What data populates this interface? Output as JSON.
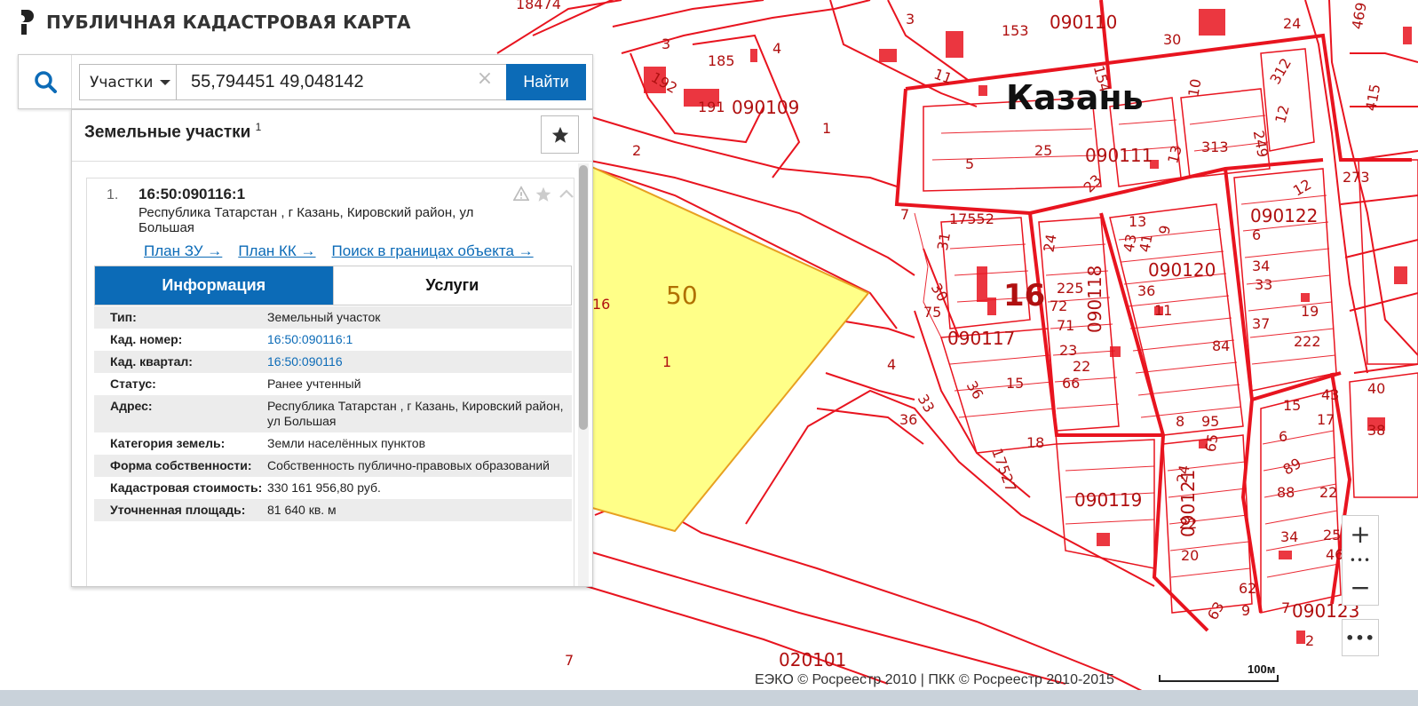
{
  "app": {
    "title": "ПУБЛИЧНАЯ КАДАСТРОВАЯ КАРТА"
  },
  "search": {
    "type_label": "Участки",
    "query": "55,794451 49,048142",
    "clear_label": "×",
    "submit_label": "Найти"
  },
  "results": {
    "title": "Земельные участки",
    "count": "1",
    "items": [
      {
        "index": "1.",
        "cad_number": "16:50:090116:1",
        "address": "Республика Татарстан , г Казань, Кировский район, ул Большая",
        "links": [
          {
            "label": "План ЗУ →"
          },
          {
            "label": "План КК →"
          },
          {
            "label": "Поиск в границах объекта →"
          }
        ],
        "tabs": [
          {
            "label": "Информация"
          },
          {
            "label": "Услуги"
          }
        ],
        "fields": [
          {
            "key": "Тип:",
            "value": "Земельный участок"
          },
          {
            "key": "Кад. номер:",
            "value": "16:50:090116:1"
          },
          {
            "key": "Кад. квартал:",
            "value": "16:50:090116"
          },
          {
            "key": "Статус:",
            "value": "Ранее учтенный"
          },
          {
            "key": "Адрес:",
            "value": "Республика Татарстан , г Казань, Кировский район, ул Большая"
          },
          {
            "key": "Категория земель:",
            "value": "Земли населённых пунктов"
          },
          {
            "key": "Форма собственности:",
            "value": "Собственность публично-правовых образований"
          },
          {
            "key": "Кадастровая стоимость:",
            "value": "330 161 956,80 руб."
          },
          {
            "key": "Уточненная площадь:",
            "value": "81 640 кв. м"
          }
        ]
      }
    ]
  },
  "map": {
    "city_label": "Казань",
    "district_label": "16",
    "parcel_number": "50",
    "labels": [
      "18474",
      "3",
      "090110",
      "153",
      "30",
      "24",
      "469",
      "185",
      "4",
      "192",
      "191",
      "090109",
      "1",
      "11",
      "154",
      "10",
      "312",
      "415",
      "2",
      "25",
      "5",
      "313",
      "249",
      "12",
      "090111",
      "13",
      "23",
      "273",
      "7",
      "17552",
      "090122",
      "31",
      "30",
      "16",
      "13",
      "41",
      "43",
      "9",
      "6",
      "090120",
      "34",
      "33",
      "36",
      "11",
      "24",
      "090117",
      "225",
      "72",
      "71",
      "090118",
      "19",
      "75",
      "15",
      "84",
      "222",
      "4",
      "37",
      "23",
      "36",
      "66",
      "33",
      "36",
      "95",
      "8",
      "17527",
      "18",
      "40",
      "43",
      "15",
      "17",
      "6",
      "89",
      "88",
      "22",
      "34",
      "25",
      "46",
      "65",
      "090119",
      "24",
      "22",
      "090121",
      "20",
      "62",
      "63",
      "9",
      "090123",
      "7",
      "020101"
    ],
    "colors": {
      "boundary": "#e8141f",
      "highlight_fill": "#ffff88",
      "building": "#e8141f"
    }
  },
  "controls": {
    "zoom_in": "+",
    "zoom_out": "−",
    "zoom_dots": "•••",
    "more": "•••"
  },
  "footer": {
    "copyright": "ЕЭКО © Росреестр 2010 | ПКК © Росреестр 2010-2015",
    "scale_label": "100м"
  }
}
